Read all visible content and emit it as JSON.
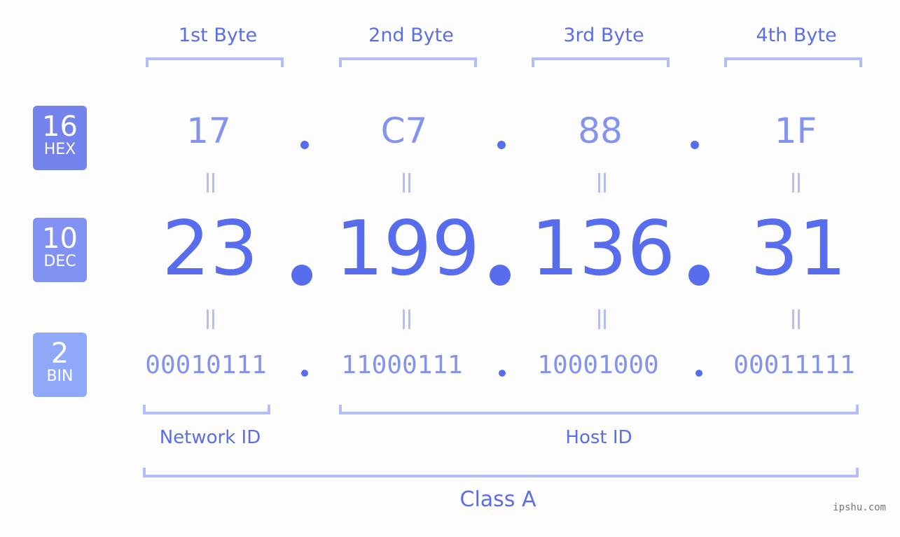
{
  "colors": {
    "hex_badge": "#7482ec",
    "dec_badge": "#8292f2",
    "bin_badge": "#8fa8f8",
    "accent": "#586ded",
    "bracket": "#b3bdf7",
    "label": "#5a6ee6"
  },
  "byte_headers": [
    "1st Byte",
    "2nd Byte",
    "3rd Byte",
    "4th Byte"
  ],
  "bases": {
    "hex": {
      "num": "16",
      "abbr": "HEX"
    },
    "dec": {
      "num": "10",
      "abbr": "DEC"
    },
    "bin": {
      "num": "2",
      "abbr": "BIN"
    }
  },
  "hex_octets": [
    "17",
    "C7",
    "88",
    "1F"
  ],
  "dec_octets": [
    "23",
    "199",
    "136",
    "31"
  ],
  "bin_octets": [
    "00010111",
    "11000111",
    "10001000",
    "00011111"
  ],
  "separator_icon": "equals-vertical-icon",
  "network_id_label": "Network ID",
  "host_id_label": "Host ID",
  "class_label": "Class A",
  "watermark": "ipshu.com"
}
